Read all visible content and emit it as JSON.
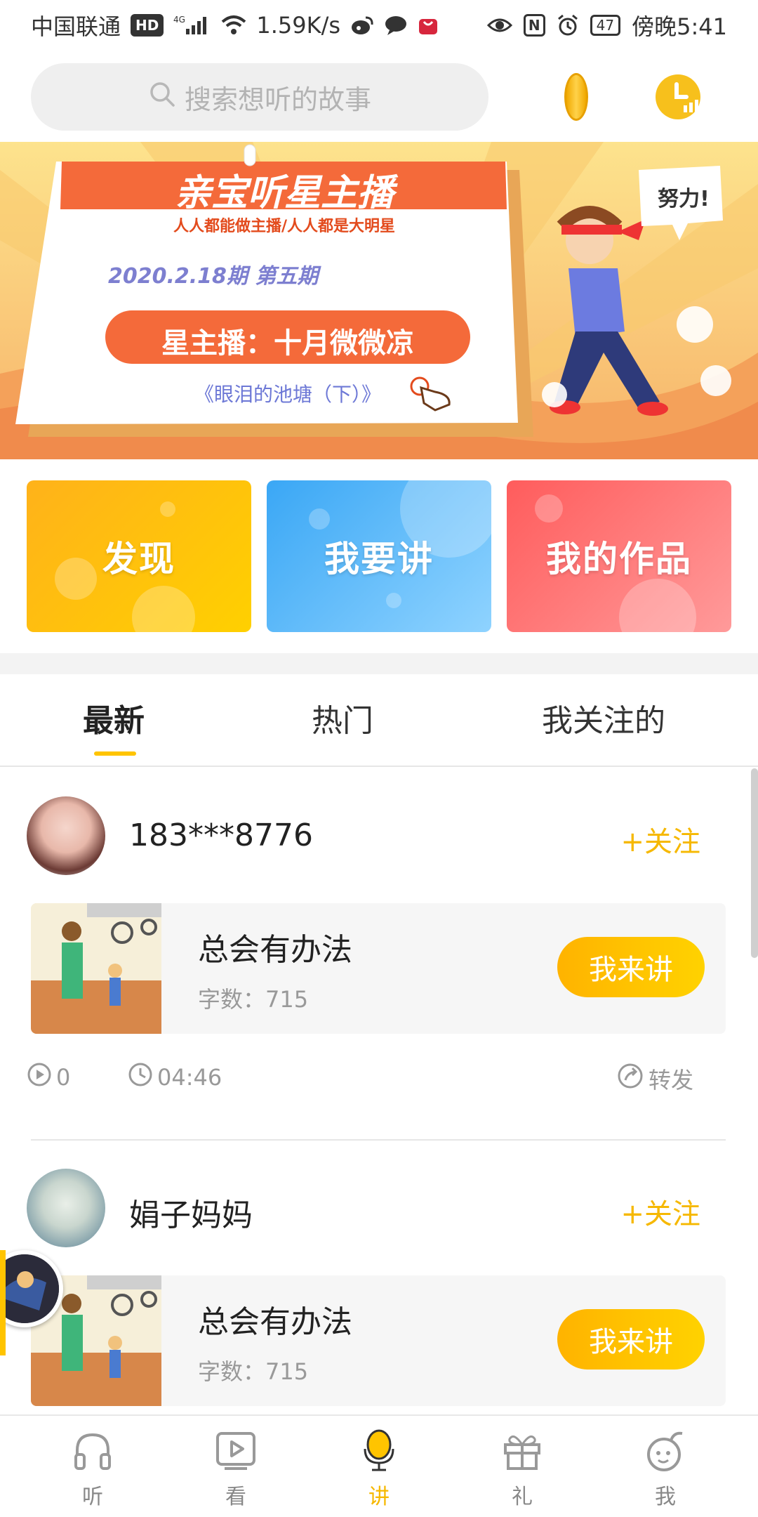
{
  "status_bar": {
    "carrier": "中国联通",
    "hd": "HD",
    "network": "4G",
    "speed": "1.59K/s",
    "nfc": "N",
    "battery": "47",
    "time": "傍晚5:41"
  },
  "search": {
    "placeholder": "搜索想听的故事"
  },
  "banner": {
    "title": "亲宝听星主播",
    "subtitle": "人人都能做主播/人人都是大明星",
    "issue": "2020.2.18期 第五期",
    "host": "星主播：十月微微凉",
    "story": "《眼泪的池塘（下）》",
    "speech": "努力!"
  },
  "cards": [
    {
      "label": "发现"
    },
    {
      "label": "我要讲"
    },
    {
      "label": "我的作品"
    }
  ],
  "tabs": [
    {
      "label": "最新"
    },
    {
      "label": "热门"
    },
    {
      "label": "我关注的"
    }
  ],
  "posts": [
    {
      "user": "183***8776",
      "follow": "+关注",
      "story_title": "总会有办法",
      "word_count": "字数：715",
      "action": "我来讲",
      "plays": "0",
      "duration": "04:46",
      "share": "转发"
    },
    {
      "user": "娟子妈妈",
      "follow": "+关注",
      "story_title": "总会有办法",
      "word_count": "字数：715",
      "action": "我来讲"
    }
  ],
  "nav": [
    {
      "label": "听",
      "icon": "headphones-icon"
    },
    {
      "label": "看",
      "icon": "play-icon"
    },
    {
      "label": "讲",
      "icon": "microphone-icon"
    },
    {
      "label": "礼",
      "icon": "gift-icon"
    },
    {
      "label": "我",
      "icon": "profile-icon"
    }
  ],
  "colors": {
    "accent": "#f6b800",
    "card_orange": "#ffb21a",
    "card_blue": "#3aa7f5",
    "card_red": "#ff5c5c"
  }
}
